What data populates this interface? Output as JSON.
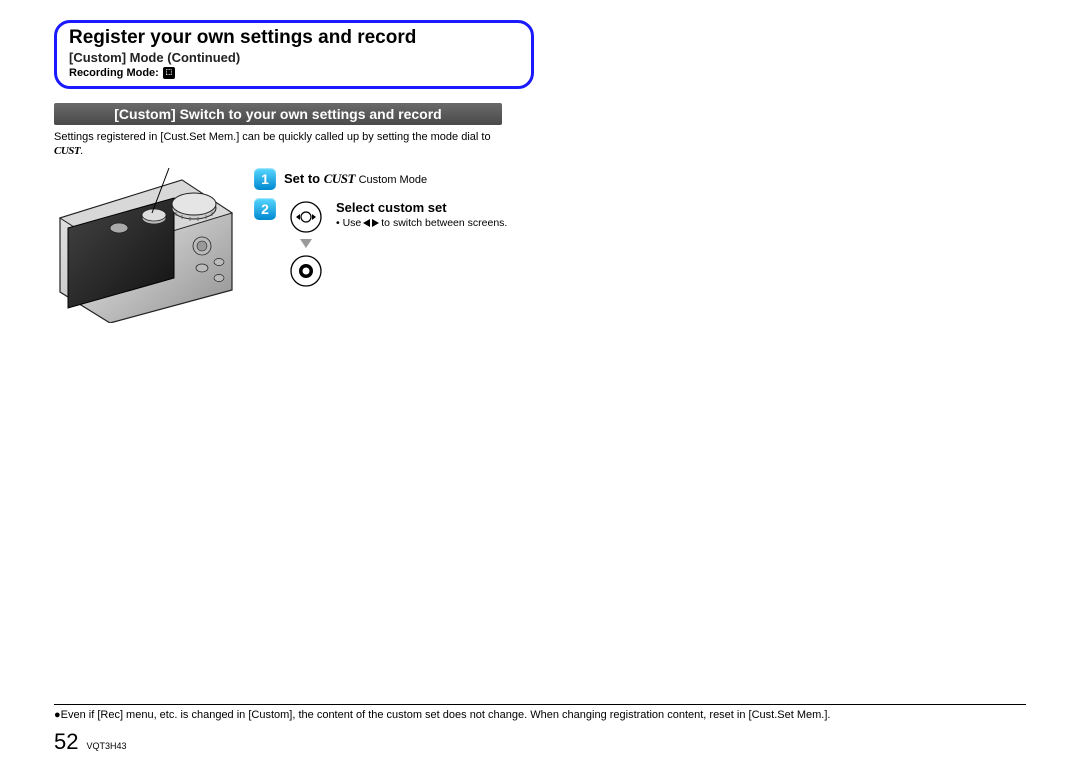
{
  "header": {
    "title": "Register your own settings and record",
    "subtitle_label": "[Custom] Mode",
    "subtitle_cont": "(Continued)",
    "recording_label": "Recording Mode:",
    "recording_icon_name": "custom-mode-icon"
  },
  "section_heading": "[Custom] Switch to your own settings and record",
  "intro_prefix": "Settings registered in [Cust.Set Mem.] can be quickly called up by setting the mode dial to ",
  "intro_cust": "CUST",
  "intro_suffix": ".",
  "steps": [
    {
      "num": "1",
      "title_prefix": "Set to ",
      "title_cust": "CUST",
      "note": " Custom Mode"
    },
    {
      "num": "2",
      "title": "Select custom set",
      "sub_prefix": "• Use ",
      "sub_suffix": " to switch between screens."
    }
  ],
  "footnote": "●Even if [Rec] menu, etc. is changed in [Custom], the content of the custom set does not change. When changing registration content, reset in [Cust.Set Mem.].",
  "page_number": "52",
  "doc_code": "VQT3H43"
}
